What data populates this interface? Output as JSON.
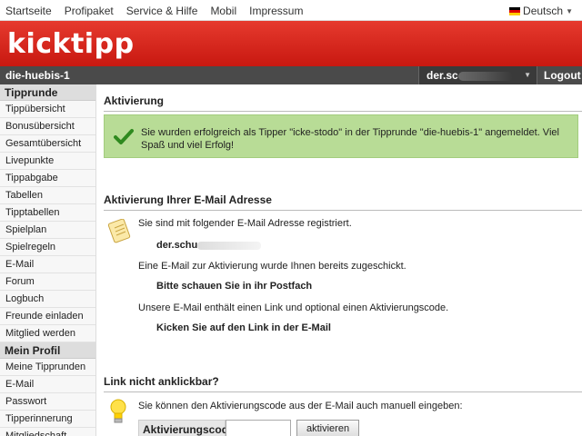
{
  "topnav": {
    "links": [
      "Startseite",
      "Profipaket",
      "Service & Hilfe",
      "Mobil",
      "Impressum"
    ],
    "language": "Deutsch"
  },
  "banner": {
    "logo": "kicktipp"
  },
  "darkbar": {
    "group": "die-huebis-1",
    "user": "der.sc",
    "logout": "Logout"
  },
  "sidebar": {
    "section1": "Tipprunde",
    "items1": [
      "Tippübersicht",
      "Bonusübersicht",
      "Gesamtübersicht",
      "Livepunkte",
      "Tippabgabe",
      "Tabellen",
      "Tipptabellen",
      "Spielplan",
      "Spielregeln",
      "E-Mail",
      "Forum",
      "Logbuch",
      "Freunde einladen",
      "Mitglied werden"
    ],
    "section2": "Mein Profil",
    "items2": [
      "Meine Tipprunden",
      "E-Mail",
      "Passwort",
      "Tipperinnerung",
      "Mitgliedschaft beenden"
    ]
  },
  "main": {
    "title1": "Aktivierung",
    "success_msg": "Sie wurden erfolgreich als Tipper \"icke-stodo\" in der Tipprunde \"die-huebis-1\" angemeldet. Viel Spaß und viel Erfolg!",
    "title2": "Aktivierung Ihrer E-Mail Adresse",
    "reg_text": "Sie sind mit folgender E-Mail Adresse registriert.",
    "email": "der.schu",
    "sent_text": "Eine E-Mail zur Aktivierung wurde Ihnen bereits zugeschickt.",
    "postfach": "Bitte schauen Sie in ihr Postfach",
    "contains_text": "Unsere E-Mail enthält einen Link und optional einen Aktivierungscode.",
    "click_link": "Kicken Sie auf den Link in der E-Mail",
    "title3": "Link nicht anklickbar?",
    "manual_text": "Sie können den Aktivierungscode aus der E-Mail auch manuell eingeben:",
    "code_label": "Aktivierungscode",
    "activate_button": "aktivieren"
  }
}
